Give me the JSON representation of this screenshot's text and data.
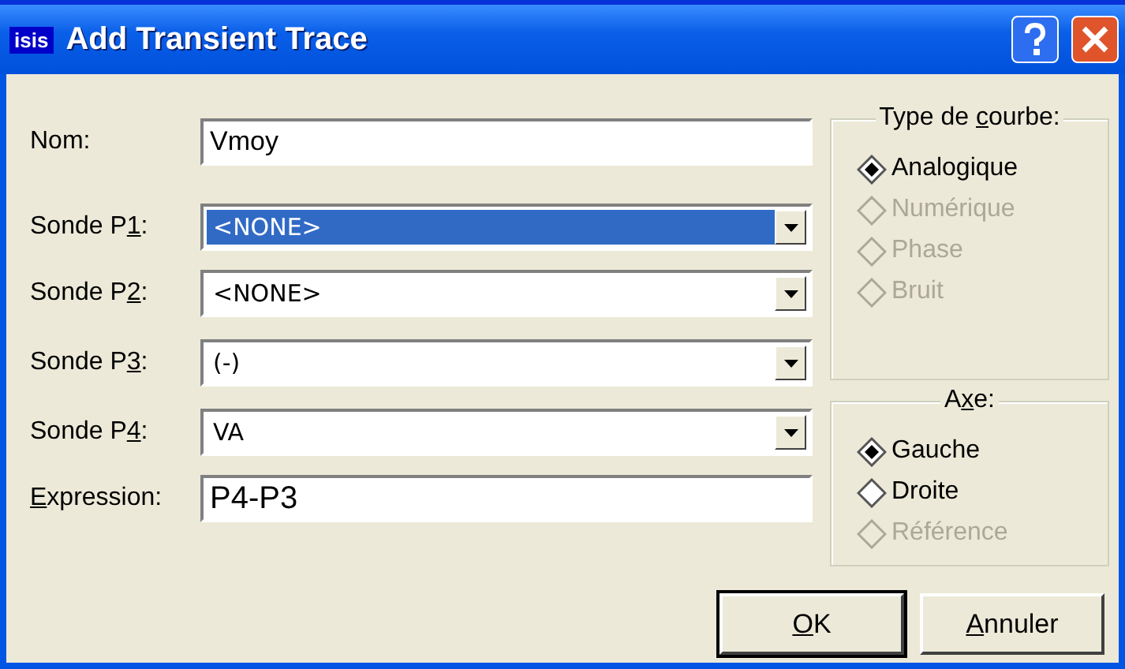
{
  "window": {
    "title": "Add Transient Trace",
    "app_icon": "isis"
  },
  "fields": [
    {
      "kind": "text",
      "label_parts": [
        {
          "text": "Nom:",
          "underlined": false
        }
      ],
      "value": "Vmoy"
    },
    {
      "kind": "combo",
      "label_parts": [
        {
          "text": "Sonde P",
          "underlined": false
        },
        {
          "text": "1",
          "underlined": true
        },
        {
          "text": ":",
          "underlined": false
        }
      ],
      "value": "<NONE>",
      "highlighted": true
    },
    {
      "kind": "combo",
      "label_parts": [
        {
          "text": "Sonde P",
          "underlined": false
        },
        {
          "text": "2",
          "underlined": true
        },
        {
          "text": ":",
          "underlined": false
        }
      ],
      "value": "<NONE>",
      "highlighted": false
    },
    {
      "kind": "combo",
      "label_parts": [
        {
          "text": "Sonde P",
          "underlined": false
        },
        {
          "text": "3",
          "underlined": true
        },
        {
          "text": ":",
          "underlined": false
        }
      ],
      "value": "(-)",
      "highlighted": false
    },
    {
      "kind": "combo",
      "label_parts": [
        {
          "text": "Sonde P",
          "underlined": false
        },
        {
          "text": "4",
          "underlined": true
        },
        {
          "text": ":",
          "underlined": false
        }
      ],
      "value": "VA",
      "highlighted": false
    },
    {
      "kind": "text",
      "label_parts": [
        {
          "text": "E",
          "underlined": true
        },
        {
          "text": "xpression:",
          "underlined": false
        }
      ],
      "value": "P4-P3"
    }
  ],
  "groups": [
    {
      "title_parts": [
        {
          "text": "Type de ",
          "underlined": false
        },
        {
          "text": "c",
          "underlined": true
        },
        {
          "text": "ourbe:",
          "underlined": false
        }
      ],
      "options": [
        {
          "label": "Analogique",
          "selected": true,
          "disabled": false
        },
        {
          "label": "Numérique",
          "selected": false,
          "disabled": true
        },
        {
          "label": "Phase",
          "selected": false,
          "disabled": true
        },
        {
          "label": "Bruit",
          "selected": false,
          "disabled": true
        }
      ]
    },
    {
      "title_parts": [
        {
          "text": "A",
          "underlined": false
        },
        {
          "text": "x",
          "underlined": true
        },
        {
          "text": "e:",
          "underlined": false
        }
      ],
      "options": [
        {
          "label": "Gauche",
          "selected": true,
          "disabled": false
        },
        {
          "label": "Droite",
          "selected": false,
          "disabled": false
        },
        {
          "label": "Référence",
          "selected": false,
          "disabled": true
        }
      ]
    }
  ],
  "buttons": [
    {
      "label_parts": [
        {
          "text": "O",
          "underlined": true
        },
        {
          "text": "K",
          "underlined": false
        }
      ],
      "default": true
    },
    {
      "label_parts": [
        {
          "text": "A",
          "underlined": true
        },
        {
          "text": "nnuler",
          "underlined": false
        }
      ],
      "default": false
    }
  ]
}
